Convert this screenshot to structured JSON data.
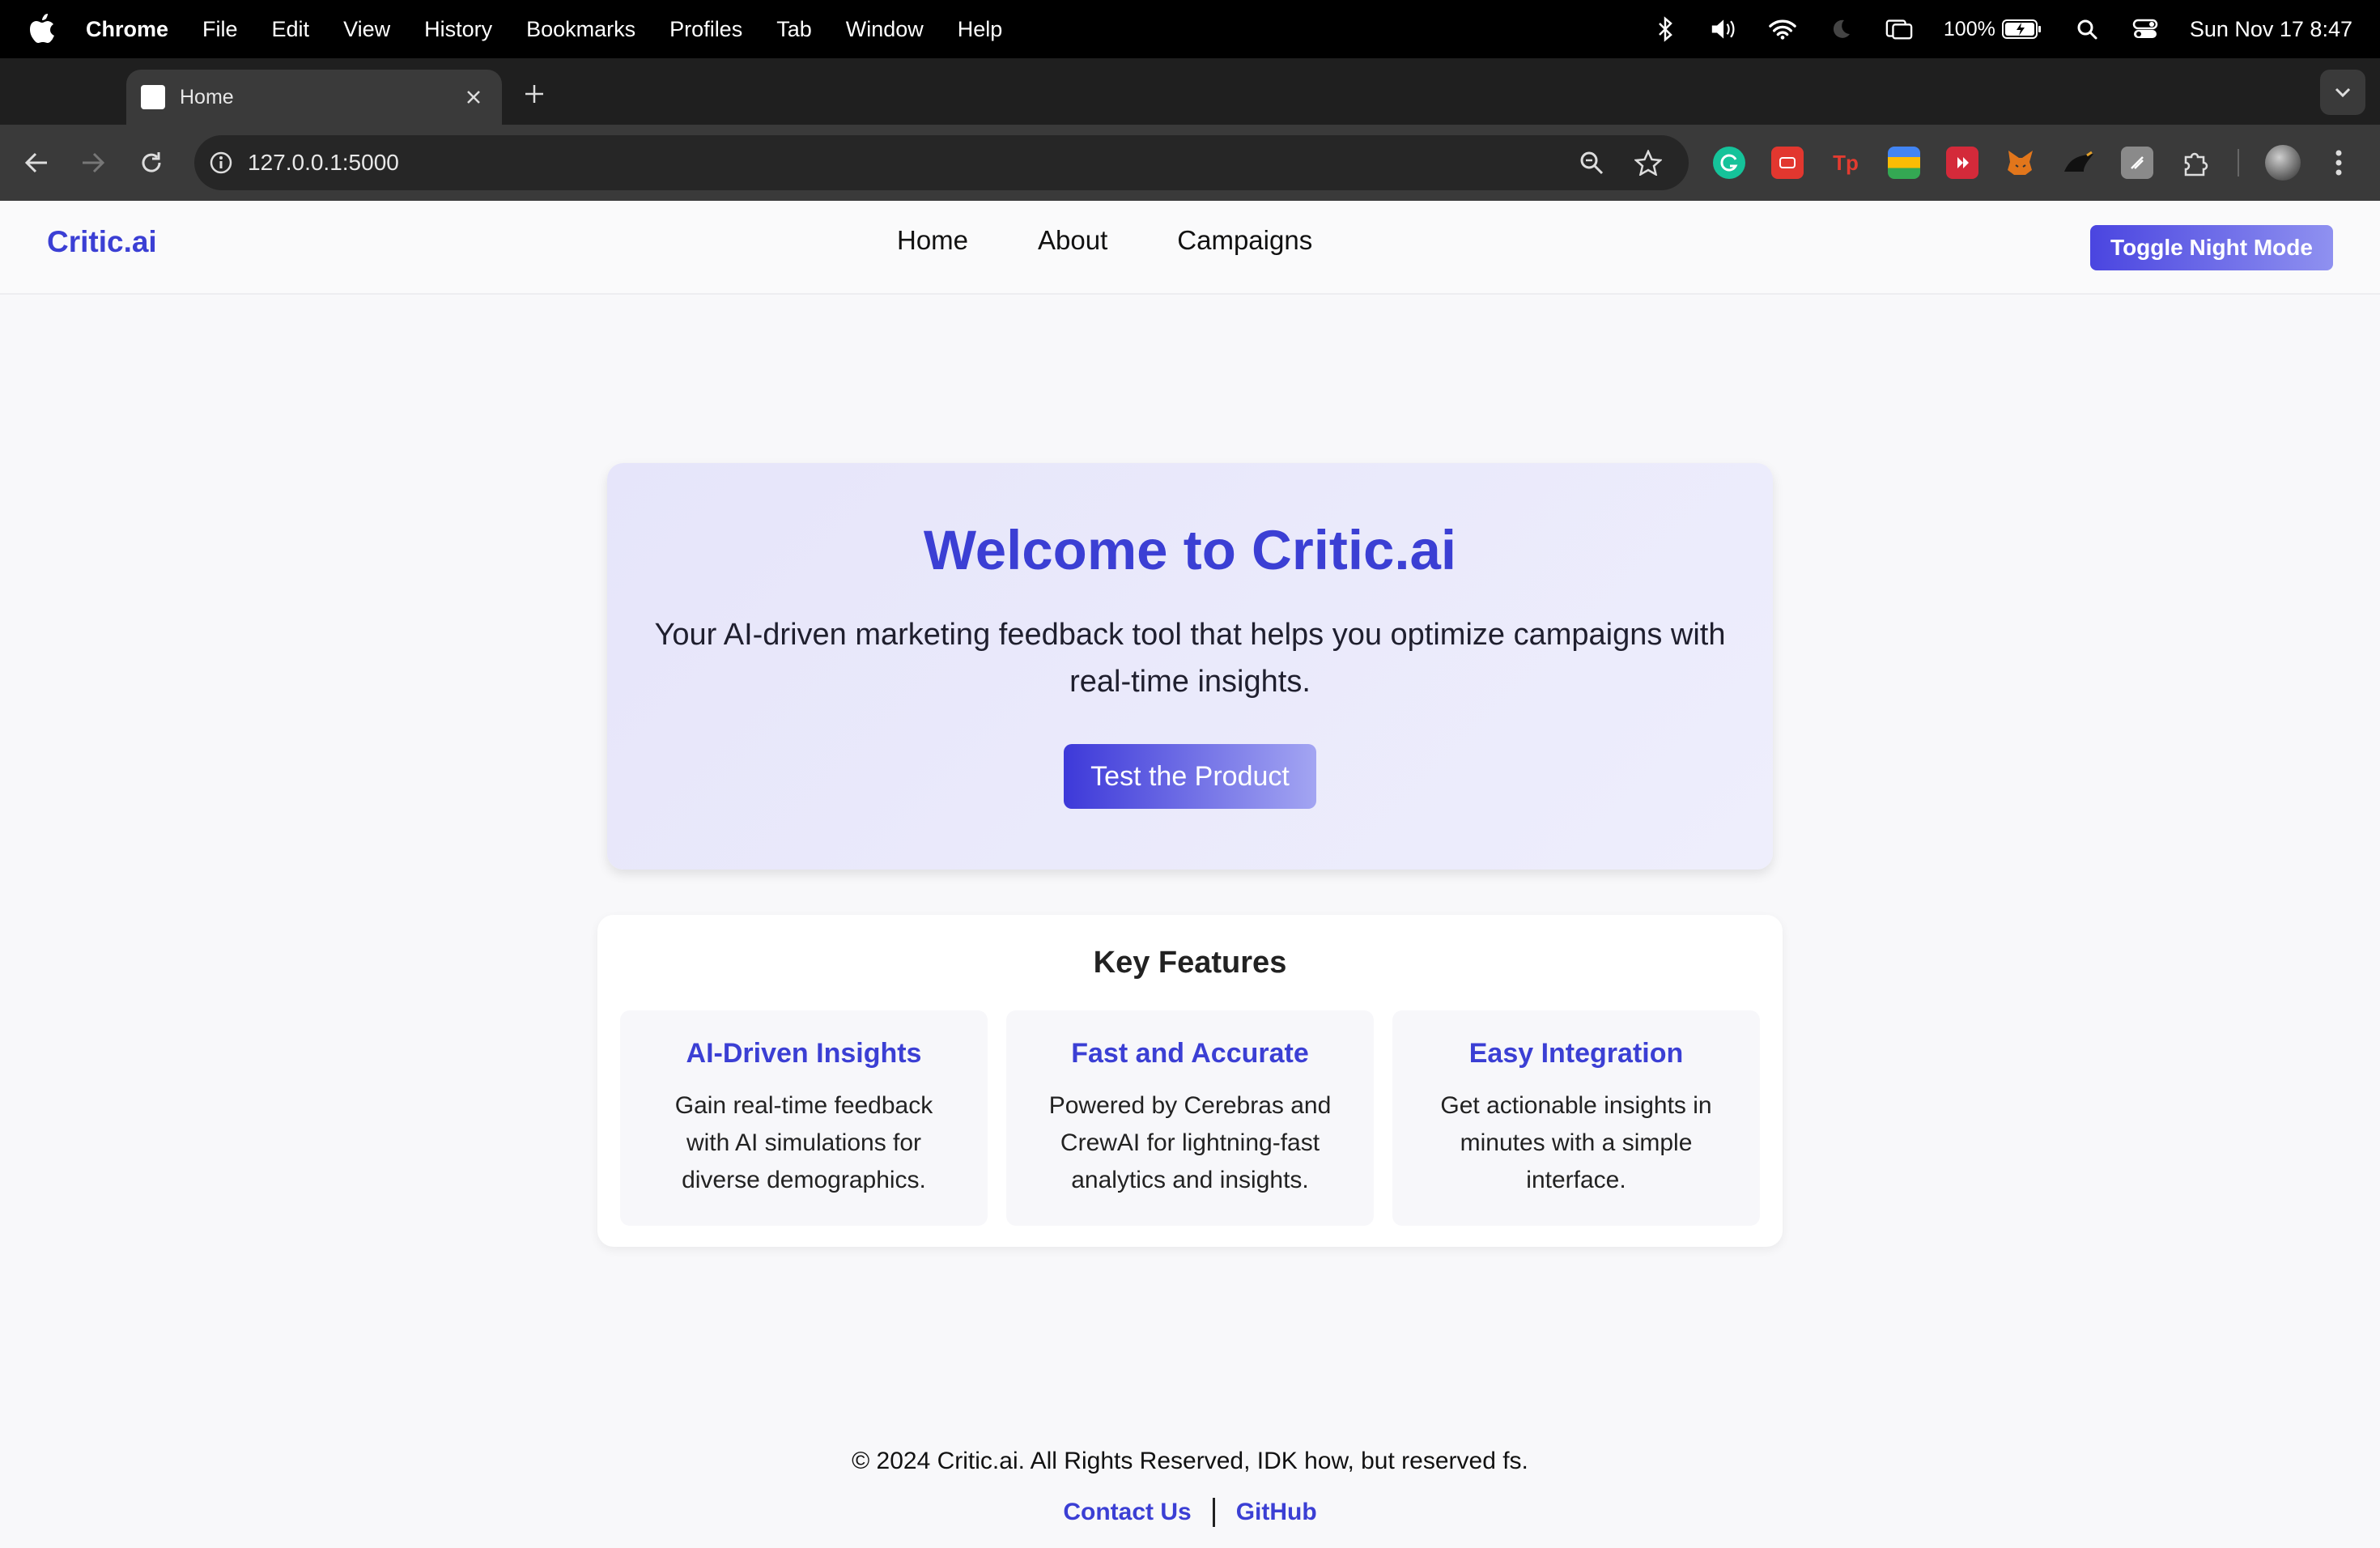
{
  "menubar": {
    "app_name": "Chrome",
    "items": [
      "File",
      "Edit",
      "View",
      "History",
      "Bookmarks",
      "Profiles",
      "Tab",
      "Window",
      "Help"
    ],
    "battery": "100%",
    "clock": "Sun Nov 17  8:47",
    "icons": [
      "apple-icon",
      "bluetooth-icon",
      "volume-icon",
      "wifi-icon",
      "moon-icon",
      "screen-mirror-icon",
      "battery-icon",
      "spotlight-icon",
      "control-center-icon"
    ]
  },
  "browser": {
    "tab": {
      "title": "Home"
    },
    "url": "127.0.0.1:5000",
    "extensions": [
      "grammarly-icon",
      "video-ext-icon",
      "tp-icon",
      "colorful-ext-icon",
      "red-play-ext-icon",
      "fox-ext-icon",
      "dark-ext-icon",
      "grey-ext-icon",
      "puzzle-extensions-icon"
    ],
    "ext_labels": {
      "tp": "Tp"
    }
  },
  "site": {
    "brand": "Critic.ai",
    "nav": {
      "home": "Home",
      "about": "About",
      "campaigns": "Campaigns"
    },
    "night_mode": "Toggle Night Mode",
    "hero": {
      "title": "Welcome to Critic.ai",
      "subtitle": "Your AI-driven marketing feedback tool that helps you optimize campaigns with real-time insights.",
      "cta": "Test the Product"
    },
    "features": {
      "title": "Key Features",
      "items": [
        {
          "title": "AI-Driven Insights",
          "desc": "Gain real-time feedback with AI simulations for diverse demographics."
        },
        {
          "title": "Fast and Accurate",
          "desc": "Powered by Cerebras and CrewAI for lightning-fast analytics and insights."
        },
        {
          "title": "Easy Integration",
          "desc": "Get actionable insights in minutes with a simple interface."
        }
      ]
    },
    "footer": {
      "copyright": "© 2024 Critic.ai. All Rights Reserved, IDK how, but reserved fs.",
      "contact": "Contact Us",
      "github": "GitHub"
    }
  },
  "colors": {
    "accent": "#3b3fd4",
    "menubar": "#000000",
    "toolbar": "#3a3a3a"
  }
}
